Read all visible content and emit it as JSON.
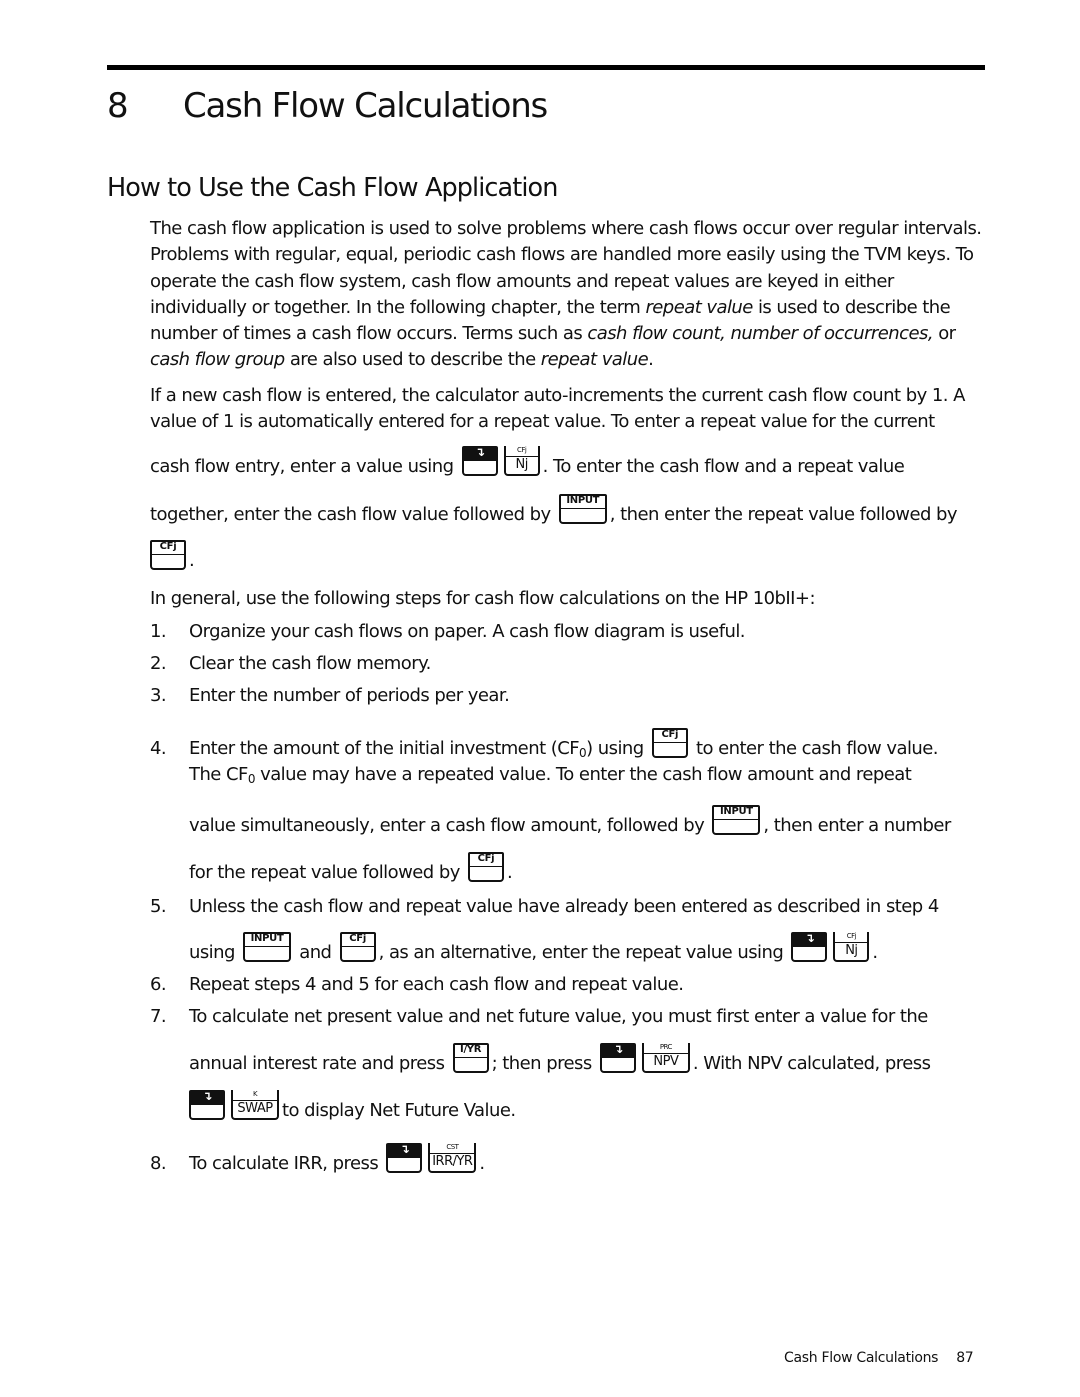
{
  "chapter": {
    "number": "8",
    "title": "Cash Flow Calculations"
  },
  "section": {
    "title": "How to Use the Cash Flow Application"
  },
  "intro": {
    "p1_a": "The cash flow application is used to solve problems where cash flows occur over regular intervals. Problems with regular, equal, periodic cash flows are handled more easily using the TVM keys. To operate the cash flow system, cash flow amounts and repeat values are keyed in either individually or together. In the following chapter, the term ",
    "p1_em1": "repeat value",
    "p1_b": " is used to describe the number of times a cash flow occurs. Terms such as ",
    "p1_em2": "cash flow count, number of occurrences,",
    "p1_c": " or ",
    "p1_em3": "cash flow group",
    "p1_d": " are also used to describe the ",
    "p1_em4": "repeat value",
    "p1_e": ".",
    "p2": "If a new cash flow is entered, the calculator auto-increments the current cash flow count by 1. A value of 1 is automatically entered for a repeat value. To enter a repeat value for the current",
    "p2_line3_a": "cash flow entry, enter a value using",
    "p2_line3_b": ". To enter the cash flow and a repeat value",
    "p2_line4_a": "together, enter the cash flow value followed by",
    "p2_line4_b": ", then enter the repeat value followed by",
    "p2_line5_end": "."
  },
  "steps_intro": "In general, use the following steps for cash flow calculations on the HP 10bII+:",
  "steps": [
    {
      "num": "1.",
      "text": "Organize your cash flows on paper. A cash flow diagram is useful."
    },
    {
      "num": "2.",
      "text": "Clear the cash flow memory."
    },
    {
      "num": "3.",
      "text": "Enter the number of periods per year."
    },
    {
      "num": "4.",
      "l1_a": "Enter the amount of the initial investment (CF",
      "l1_sub": "0",
      "l1_b": ") using",
      "l1_c": "to enter the cash flow value.",
      "l2_a": "The CF",
      "l2_sub": "0",
      "l2_b": " value may have a repeated value. To enter the cash flow amount and repeat",
      "l3_a": "value simultaneously, enter a cash flow amount, followed by",
      "l3_b": ", then enter a number",
      "l4_a": "for the repeat value followed by",
      "l4_b": "."
    },
    {
      "num": "5.",
      "l1": "Unless the cash flow and repeat value have already been entered as described in step 4",
      "l2_a": "using",
      "l2_b": "and",
      "l2_c": ", as an alternative, enter the repeat value using",
      "l2_d": "."
    },
    {
      "num": "6.",
      "text": "Repeat steps 4 and 5 for each cash flow and repeat value."
    },
    {
      "num": "7.",
      "l1": "To calculate net present value and net future value, you must first enter a value for the",
      "l2_a": "annual interest rate and press",
      "l2_b": "; then press",
      "l2_c": ". With NPV calculated, press",
      "l3": "to display Net Future Value."
    },
    {
      "num": "8.",
      "l1_a": "To calculate IRR, press",
      "l1_b": "."
    }
  ],
  "keys": {
    "shift": "↴",
    "cfj": "CFj",
    "input": "INPUT",
    "nj_above": "CFj",
    "nj": "Nj",
    "iyr": "I/YR",
    "npv_above": "PRC",
    "npv": "NPV",
    "swap_above": "K",
    "swap": "SWAP",
    "irr_above": "CST",
    "irr": "IRR/YR"
  },
  "footer": {
    "running_title": "Cash Flow Calculations",
    "page_number": "87"
  }
}
